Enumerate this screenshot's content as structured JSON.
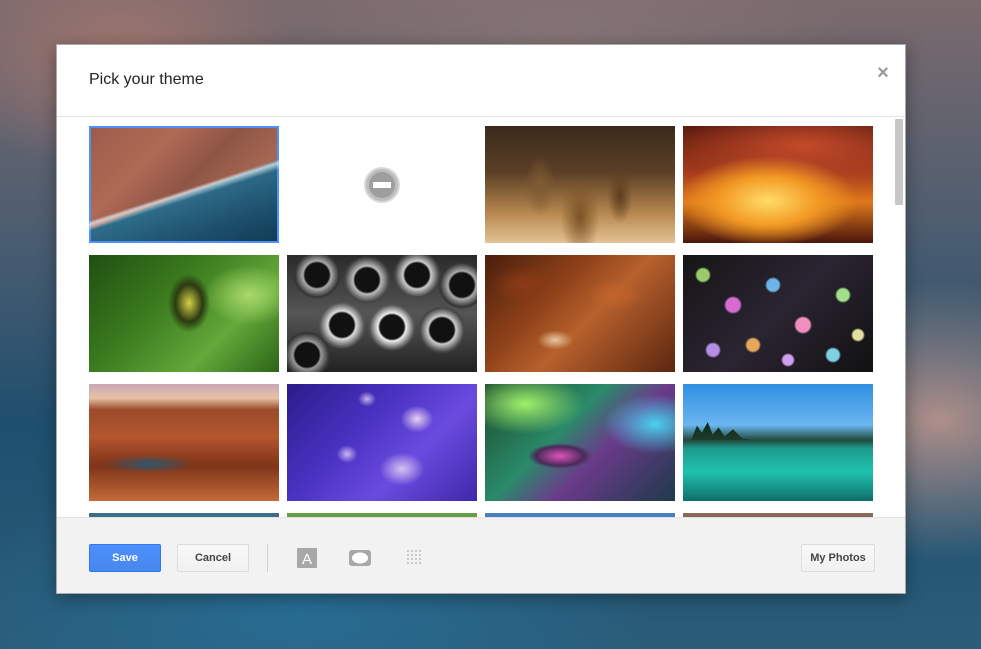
{
  "dialog": {
    "title": "Pick your theme",
    "close_symbol": "×"
  },
  "themes": [
    {
      "name": "coast-aerial",
      "selected": true
    },
    {
      "name": "no-theme",
      "selected": false
    },
    {
      "name": "chess",
      "selected": false
    },
    {
      "name": "canyon-glow",
      "selected": false
    },
    {
      "name": "caterpillar",
      "selected": false
    },
    {
      "name": "pipes",
      "selected": false
    },
    {
      "name": "autumn-leaves",
      "selected": false
    },
    {
      "name": "bokeh-lights",
      "selected": false
    },
    {
      "name": "grand-canyon",
      "selected": false
    },
    {
      "name": "jellyfish",
      "selected": false
    },
    {
      "name": "color-ripple",
      "selected": false
    },
    {
      "name": "lake",
      "selected": false
    }
  ],
  "footer": {
    "save_label": "Save",
    "cancel_label": "Cancel",
    "my_photos_label": "My Photos",
    "tools": [
      "text-background-icon",
      "vignette-icon",
      "blur-icon"
    ],
    "text_icon_letter": "A"
  },
  "colors": {
    "accent": "#4d90fe",
    "save_border": "#3079ed",
    "footer_bg": "#f2f2f2"
  }
}
